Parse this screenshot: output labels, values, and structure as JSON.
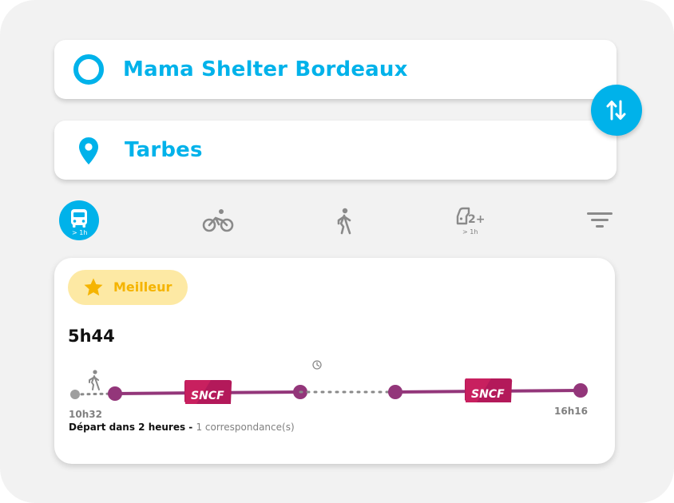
{
  "search": {
    "origin": "Mama Shelter Bordeaux",
    "destination": "Tarbes"
  },
  "modes": [
    {
      "name": "public-transport",
      "sub": "> 1h",
      "selected": true
    },
    {
      "name": "bike",
      "sub": "",
      "selected": false
    },
    {
      "name": "walk",
      "sub": "",
      "selected": false
    },
    {
      "name": "carpool",
      "sub": "> 1h",
      "selected": false
    },
    {
      "name": "filter",
      "sub": "",
      "selected": false
    }
  ],
  "result": {
    "badge": "Meilleur",
    "duration": "5h44",
    "depart_time": "10h32",
    "arrive_time": "16h16",
    "summary_bold": "Départ dans 2 heures - ",
    "summary_grey": "1 correspondance(s)",
    "operator": "SNCF"
  },
  "colors": {
    "accent": "#00b2ea",
    "rail_line": "#93367a",
    "badge_bg": "#fde9a4",
    "badge_text": "#f5b400"
  }
}
